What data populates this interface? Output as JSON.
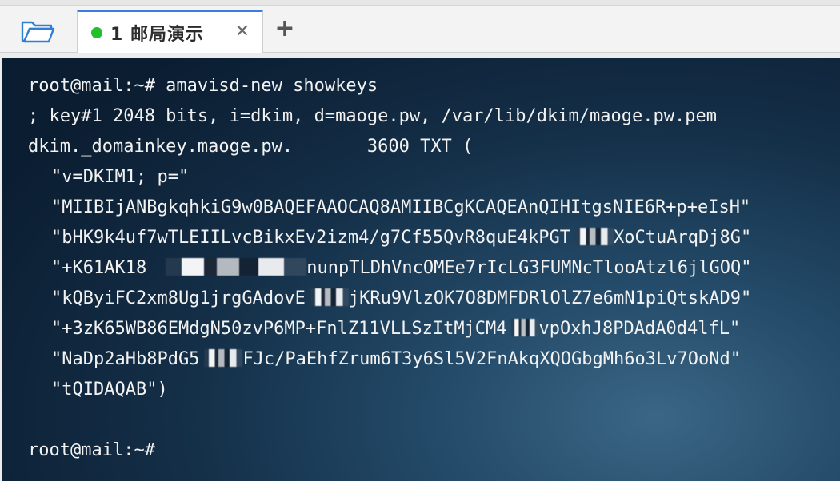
{
  "tabbar": {
    "folder_icon": "folder-open-icon",
    "tab": {
      "number": "1",
      "title": "邮局演示",
      "status_color": "#22c02b",
      "close_glyph": "✕"
    },
    "new_tab_glyph": "+"
  },
  "terminal": {
    "lines": [
      "root@mail:~# amavisd-new showkeys",
      "; key#1 2048 bits, i=dkim, d=maoge.pw, /var/lib/dkim/maoge.pw.pem",
      "dkim._domainkey.maoge.pw.       3600 TXT (",
      "\"v=DKIM1; p=\"",
      "\"MIIBIjANBgkqhkiG9w0BAQEFAAOCAQ8AMIIBCgKCAQEAnQIHItgsNIE6R+p+eIsH\"",
      "\"bHK9k4uf7wTLEIILvcBikxEv2izm4/g7Cf55QvR8quE4kPGT",
      "XoCtuArqDj8G\"",
      "\"+K61AK18",
      "nunpTLDhVncOMEe7rIcLG3FUMNcTlooAtzl6jlGOQ\"",
      "\"kQByiFC2xm8Ug1jrgGAdovE",
      "jKRu9VlzOK7O8DMFDRlOlZ7e6mN1piQtskAD9\"",
      "\"+3zK65WB86EMdgN50zvP6MP+FnlZ11VLLSzItMjCM4",
      "vpOxhJ8PDAdA0d4lfL\"",
      "\"NaDp2aHb8PdG5",
      "FJc/PaEhfZrum6T3y6Sl5V2FnAkqXQOGbgMh6o3Lv7OoNd\"",
      "\"tQIDAQAB\")",
      "root@mail:~#"
    ]
  }
}
